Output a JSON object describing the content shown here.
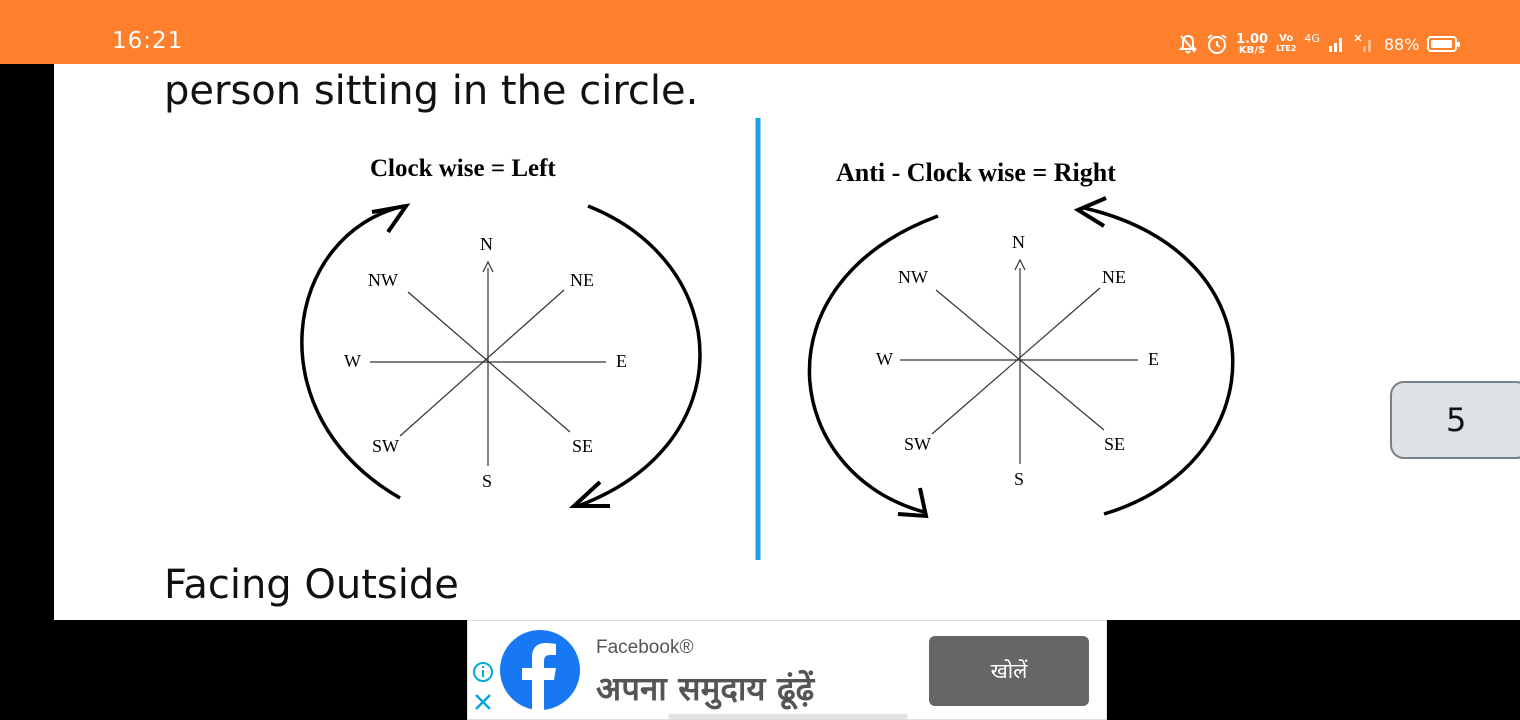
{
  "status_bar": {
    "time": "16:21",
    "speed_value": "1.00",
    "speed_unit": "KB/S",
    "vo_label": "Vo",
    "lte_label": "LTE2",
    "network": "4G",
    "battery": "88%",
    "background_color": "#fe7f2c"
  },
  "document": {
    "partial_line": "person sitting in the circle.",
    "heading_facing_outside": "Facing Outside",
    "left_diagram": {
      "title": "Clock wise = Left",
      "directions": {
        "n": "N",
        "ne": "NE",
        "e": "E",
        "se": "SE",
        "s": "S",
        "sw": "SW",
        "w": "W",
        "nw": "NW"
      }
    },
    "right_diagram": {
      "title": "Anti - Clock wise = Right",
      "directions": {
        "n": "N",
        "ne": "NE",
        "e": "E",
        "se": "SE",
        "s": "S",
        "sw": "SW",
        "w": "W",
        "nw": "NW"
      }
    },
    "divider_color": "#1aa3e8"
  },
  "page_indicator": {
    "label": "5"
  },
  "ad": {
    "brand": "Facebook®",
    "headline": "अपना समुदाय ढूंढ़ें",
    "button_label": "खोलें",
    "logo_color": "#1877f2"
  }
}
